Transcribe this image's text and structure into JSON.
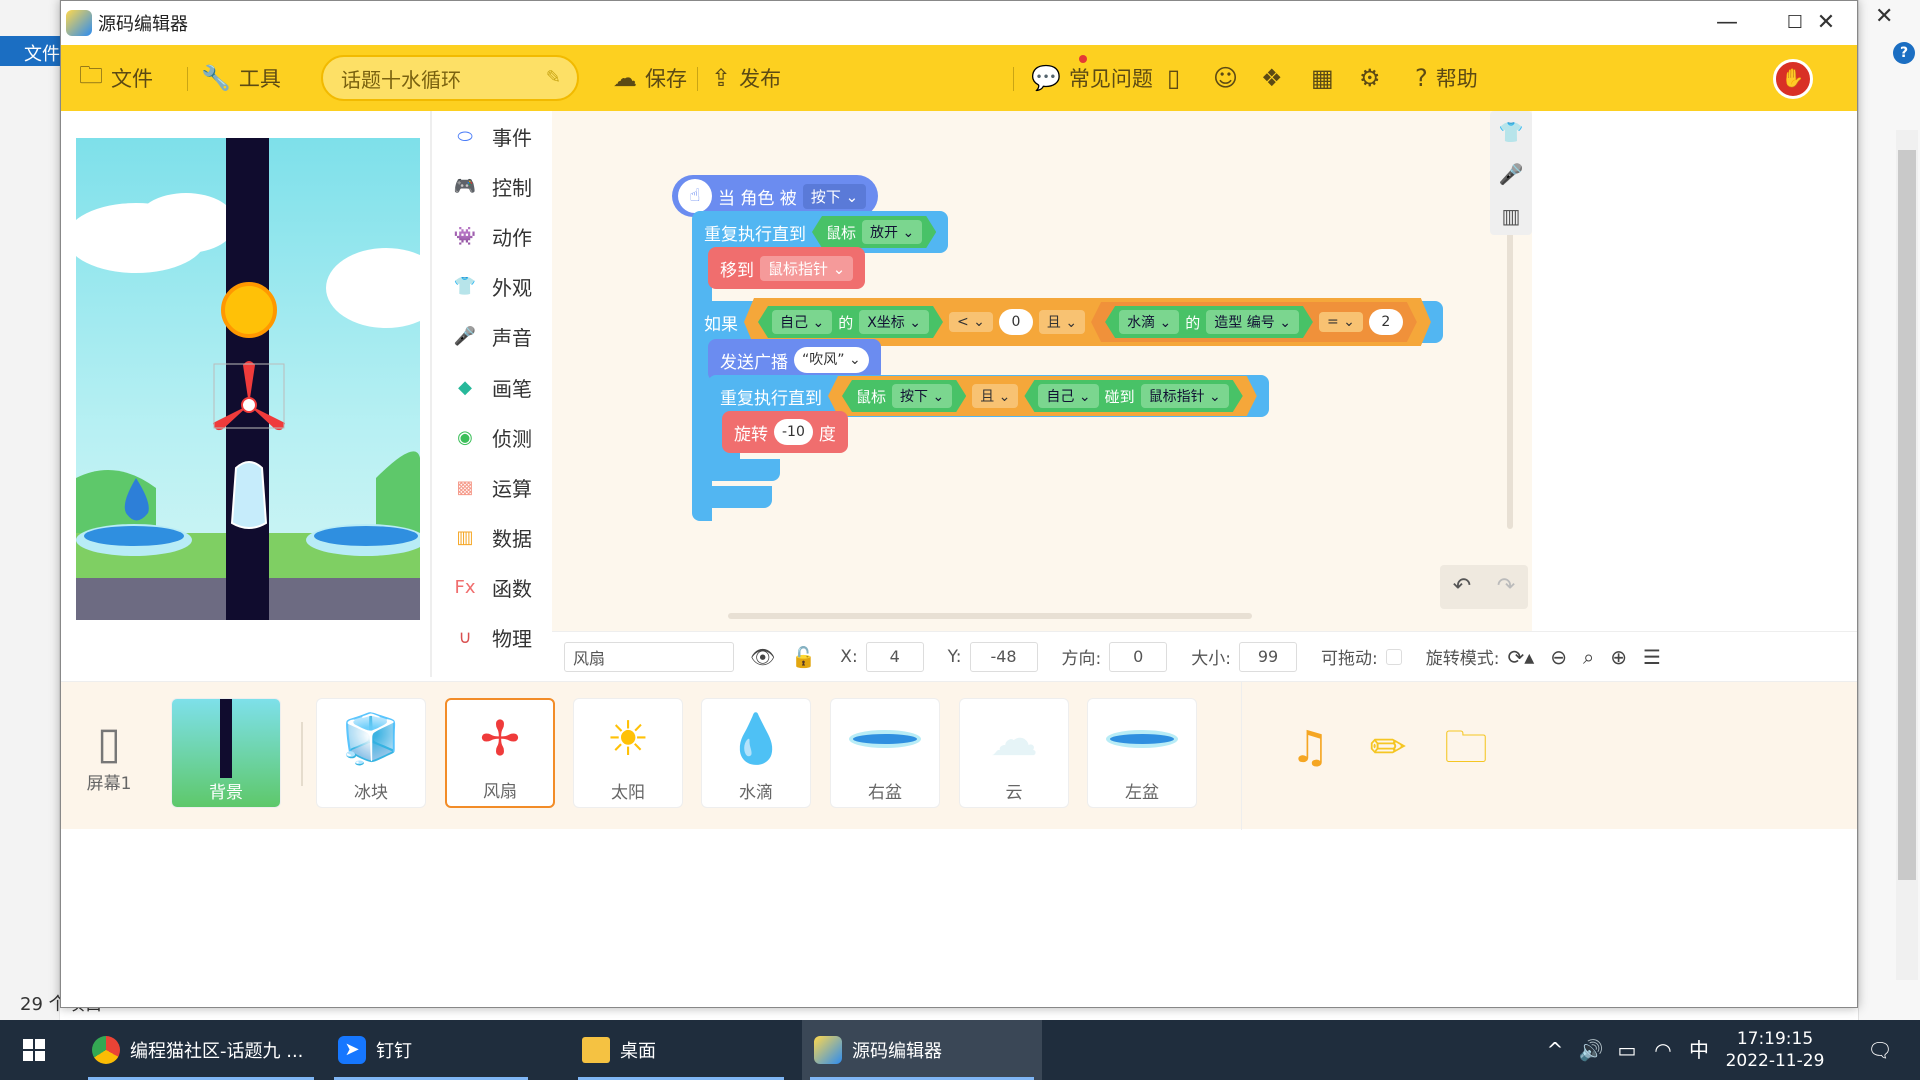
{
  "background": {
    "file_tab": "文件",
    "status_text": "29 个项目"
  },
  "window": {
    "title": "源码编辑器",
    "minimize": "—",
    "maximize": "☐",
    "close": "✕"
  },
  "toolbar": {
    "file_label": "文件",
    "tools_label": "工具",
    "topic_name": "话题十水循环",
    "save_label": "保存",
    "publish_label": "发布",
    "faq_label": "常见问题",
    "help_label": "帮助"
  },
  "categories": [
    {
      "label": "事件",
      "color": "#4a7cf7"
    },
    {
      "label": "控制",
      "color": "#39a8f2"
    },
    {
      "label": "动作",
      "color": "#f45c5c"
    },
    {
      "label": "外观",
      "color": "#e456c8"
    },
    {
      "label": "声音",
      "color": "#a56bf0"
    },
    {
      "label": "画笔",
      "color": "#27b89a"
    },
    {
      "label": "侦测",
      "color": "#3cbf5a"
    },
    {
      "label": "运算",
      "color": "#f59a8a"
    },
    {
      "label": "数据",
      "color": "#f5a623"
    },
    {
      "label": "函数",
      "color": "#f06e6e"
    },
    {
      "label": "物理",
      "color": "#d94f4f"
    }
  ],
  "blocks": {
    "event_label": "当 角色 被",
    "event_dd": "按下",
    "repeat1_label": "重复执行直到",
    "repeat1_mouse": "鼠标",
    "repeat1_state": "放开",
    "move_label": "移到",
    "move_target": "鼠标指针",
    "if_label": "如果",
    "if_self": "自己",
    "if_of": "的",
    "if_prop": "X坐标",
    "if_op": "<",
    "if_val": "0",
    "if_and": "且",
    "if_drop": "水滴",
    "if_of2": "的",
    "if_prop2": "造型 编号",
    "if_eq": "=",
    "if_val2": "2",
    "broadcast_label": "发送广播",
    "broadcast_msg": "“吹风”",
    "repeat2_label": "重复执行直到",
    "repeat2_mouse": "鼠标",
    "repeat2_state": "按下",
    "repeat2_and": "且",
    "repeat2_self": "自己",
    "repeat2_touch": "碰到",
    "repeat2_target": "鼠标指针",
    "rotate_label": "旋转",
    "rotate_val": "-10",
    "rotate_unit": "度"
  },
  "properties": {
    "sprite_name": "风扇",
    "x_label": "X:",
    "x_value": "4",
    "y_label": "Y:",
    "y_value": "-48",
    "dir_label": "方向:",
    "dir_value": "0",
    "size_label": "大小:",
    "size_value": "99",
    "drag_label": "可拖动:",
    "rotate_mode_label": "旋转模式:"
  },
  "sprites": {
    "screen_label": "屏幕1",
    "items": [
      {
        "label": "背景"
      },
      {
        "label": "冰块"
      },
      {
        "label": "风扇"
      },
      {
        "label": "太阳"
      },
      {
        "label": "水滴"
      },
      {
        "label": "右盆"
      },
      {
        "label": "云"
      },
      {
        "label": "左盆"
      }
    ]
  },
  "taskbar": {
    "apps": [
      {
        "label": "编程猫社区-话题九 ..."
      },
      {
        "label": "钉钉"
      },
      {
        "label": "桌面"
      },
      {
        "label": "源码编辑器"
      }
    ],
    "ime": "中",
    "time": "17:19:15",
    "date": "2022-11-29"
  }
}
